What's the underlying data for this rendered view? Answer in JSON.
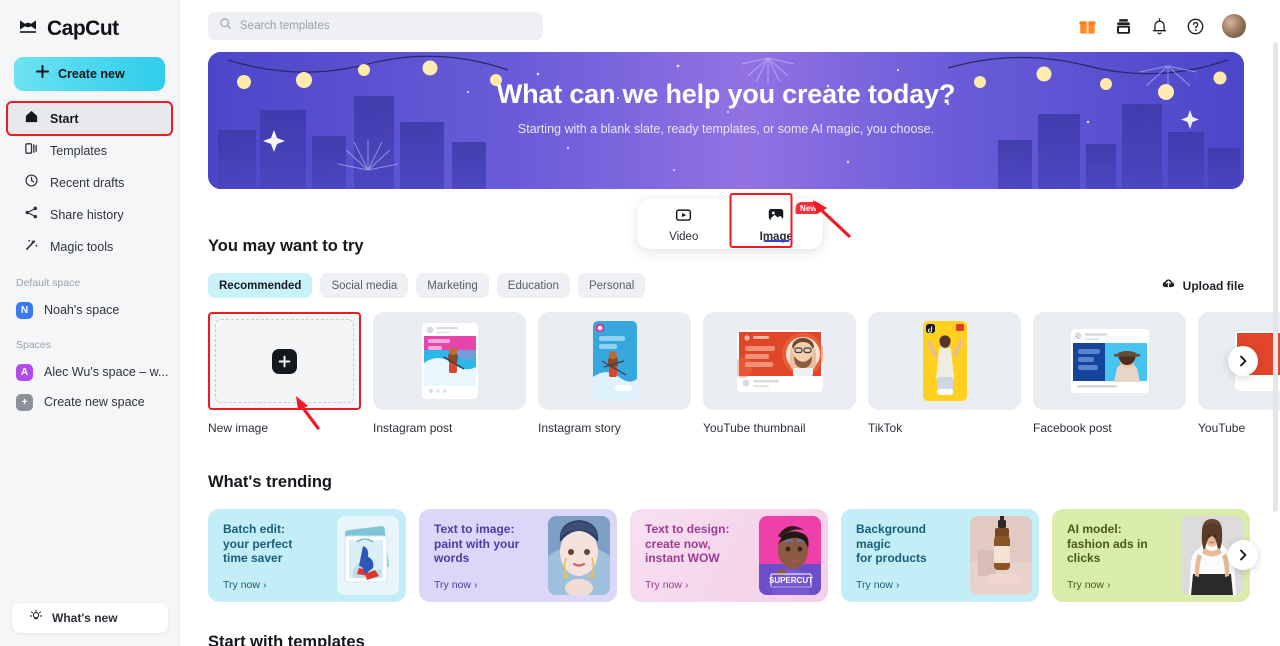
{
  "brand": {
    "name": "CapCut",
    "logo_icon": "capcut-logo-icon"
  },
  "sidebar": {
    "create_new": {
      "label": "Create new",
      "icon": "plus-icon"
    },
    "items": [
      {
        "label": "Start",
        "icon": "home-icon",
        "active": true,
        "highlighted": true
      },
      {
        "label": "Templates",
        "icon": "templates-icon",
        "active": false
      },
      {
        "label": "Recent drafts",
        "icon": "clock-icon",
        "active": false
      },
      {
        "label": "Share history",
        "icon": "share-icon",
        "active": false
      },
      {
        "label": "Magic tools",
        "icon": "magic-wand-icon",
        "active": false
      }
    ],
    "default_space_title": "Default space",
    "default_space": {
      "label": "Noah's space",
      "initial": "N",
      "color": "#3a7af0"
    },
    "spaces_title": "Spaces",
    "spaces": [
      {
        "label": "Alec Wu's space – w...",
        "initial": "A",
        "color": "#b449ee"
      },
      {
        "label": "Create new space",
        "initial": "+",
        "color": "#8b9099"
      }
    ],
    "whats_new": {
      "label": "What's new",
      "icon": "lightbulb-icon"
    }
  },
  "topbar": {
    "search": {
      "placeholder": "Search templates",
      "value": "",
      "icon": "search-icon"
    },
    "icons": [
      {
        "name": "gift-icon",
        "color": "#ff7a1a"
      },
      {
        "name": "print-icon",
        "color": "#1c1f23"
      },
      {
        "name": "bell-icon",
        "color": "#1c1f23"
      },
      {
        "name": "help-circle-icon",
        "color": "#1c1f23"
      }
    ],
    "avatar": {
      "name": "user-avatar"
    }
  },
  "hero": {
    "title": "What can we help you create today?",
    "subtitle": "Starting with a blank slate, ready templates, or some AI magic, you choose."
  },
  "mode_switch": {
    "items": [
      {
        "label": "Video",
        "icon": "video-icon",
        "active": false,
        "badge": ""
      },
      {
        "label": "Image",
        "icon": "image-icon",
        "active": true,
        "badge": "New"
      }
    ]
  },
  "try_section": {
    "title": "You may want to try",
    "chips": [
      {
        "label": "Recommended",
        "active": true
      },
      {
        "label": "Social media",
        "active": false
      },
      {
        "label": "Marketing",
        "active": false
      },
      {
        "label": "Education",
        "active": false
      },
      {
        "label": "Personal",
        "active": false
      }
    ],
    "upload": {
      "label": "Upload file",
      "icon": "upload-cloud-icon"
    },
    "cards": [
      {
        "caption": "New image",
        "kind": "new",
        "highlighted": true
      },
      {
        "caption": "Instagram post",
        "kind": "instagram-post"
      },
      {
        "caption": "Instagram story",
        "kind": "instagram-story"
      },
      {
        "caption": "YouTube thumbnail",
        "kind": "youtube-thumbnail"
      },
      {
        "caption": "TikTok",
        "kind": "tiktok"
      },
      {
        "caption": "Facebook post",
        "kind": "facebook-post"
      },
      {
        "caption": "YouTube",
        "kind": "youtube"
      }
    ],
    "next_label": "›"
  },
  "trending_section": {
    "title": "What's trending",
    "try_label": "Try now",
    "next_label": "›",
    "cards": [
      {
        "title": "Batch edit:\nyour perfect\ntime saver",
        "bg": "#c3eef7",
        "text_color": "#17607a",
        "pic": "batch-edit-thumb"
      },
      {
        "title": "Text to image:\npaint with your\nwords",
        "bg": "#dcd6f8",
        "text_color": "#4b3aa8",
        "pic": "text-to-image-thumb"
      },
      {
        "title": "Text to design:\ncreate now,\ninstant WOW",
        "bg": "#f6d5ee",
        "text_color": "#9c3c94",
        "pic": "text-to-design-thumb"
      },
      {
        "title": "Background\nmagic\nfor products",
        "bg": "#c3eef7",
        "text_color": "#17607a",
        "pic": "background-magic-thumb"
      },
      {
        "title": "AI model:\nfashion ads in\nclicks",
        "bg": "#d9ecab",
        "text_color": "#4a5b17",
        "pic": "ai-model-thumb"
      }
    ]
  },
  "templates_section": {
    "title": "Start with templates"
  }
}
